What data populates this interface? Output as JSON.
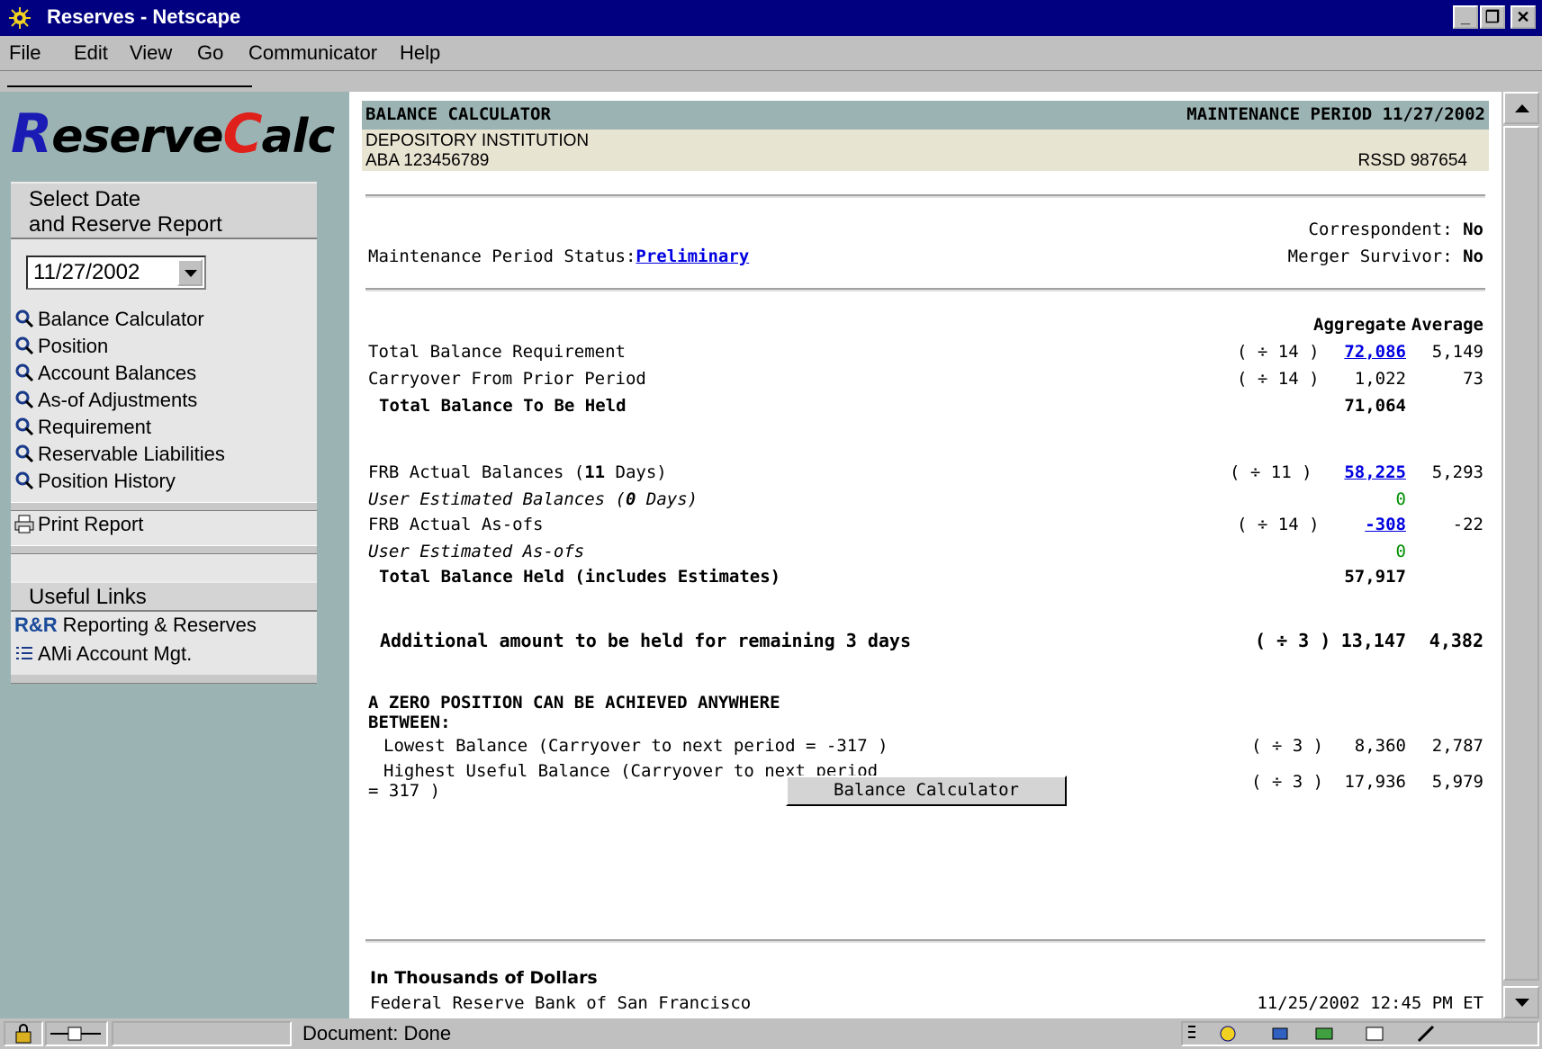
{
  "window": {
    "title": "Reserves - Netscape",
    "controls": [
      "_",
      "❐",
      "✕"
    ]
  },
  "menu": [
    "File",
    "Edit",
    "View",
    "Go",
    "Communicator",
    "Help"
  ],
  "sidebar": {
    "brand": {
      "r": "R",
      "mid": "eserve",
      "c": "C",
      "end": "alc"
    },
    "select_header": {
      "line1": "Select Date",
      "line2": "and Reserve Report"
    },
    "date_value": "11/27/2002",
    "nav": [
      "Balance Calculator",
      "Position",
      "Account Balances",
      "As-of Adjustments",
      "Requirement",
      "Reservable Liabilities",
      "Position History"
    ],
    "print_report": "Print Report",
    "useful_links_header": "Useful Links",
    "links": [
      {
        "badge": "R&R",
        "label": "Reporting & Reserves"
      },
      {
        "label": "AMi Account Mgt."
      }
    ]
  },
  "main": {
    "header_left": "BALANCE CALCULATOR",
    "header_right": "MAINTENANCE PERIOD 11/27/2002",
    "institution": "DEPOSITORY INSTITUTION",
    "aba": "ABA 123456789",
    "rssd": "RSSD 987654",
    "correspondent_label": "Correspondent:",
    "correspondent_value": "No",
    "merger_label": "Merger Survivor:",
    "merger_value": "No",
    "status_label": "Maintenance Period Status:",
    "status_value": "Preliminary",
    "col_aggregate": "Aggregate",
    "col_average": "Average",
    "rows": {
      "tbr": {
        "label": "Total Balance Requirement",
        "agg": "72,086",
        "div": "( ÷ 14 )",
        "avg": "5,149"
      },
      "carry": {
        "label": "Carryover From Prior Period",
        "agg": "1,022",
        "div": "( ÷ 14 )",
        "avg": "73"
      },
      "tbh": {
        "label": "Total Balance To Be Held",
        "agg": "71,064"
      },
      "frb_pre": "FRB Actual Balances (",
      "frb_days": "11",
      "frb_post": " Days)",
      "frb_agg": "58,225",
      "frb_div": "( ÷ 11 )",
      "frb_avg": "5,293",
      "ueb_pre": "User Estimated Balances (",
      "ueb_days": "0",
      "ueb_post": " Days)",
      "ueb_agg": "0",
      "asof": {
        "label": "FRB Actual As-ofs",
        "agg": "-308",
        "div": "( ÷ 14 )",
        "avg": "-22"
      },
      "ueasof": {
        "label": "User Estimated As-ofs",
        "agg": "0"
      },
      "held": {
        "label": "Total Balance Held (includes Estimates)",
        "agg": "57,917"
      },
      "additional": {
        "label": "Additional amount to be held for remaining 3 days",
        "agg": "13,147",
        "div": "( ÷ 3 )",
        "avg": "4,382"
      },
      "zero_line1": "A ZERO POSITION CAN BE ACHIEVED ANYWHERE",
      "zero_line2": "BETWEEN:",
      "lowest": {
        "label": "Lowest Balance (Carryover to next period = -317 )",
        "agg": "8,360",
        "div": "( ÷ 3 )",
        "avg": "2,787"
      },
      "highest": {
        "line1": "Highest Useful Balance (Carryover to next period",
        "line2": "= 317 )",
        "agg": "17,936",
        "div": "( ÷ 3 )",
        "avg": "5,979"
      }
    },
    "button": "Balance Calculator",
    "footer_units": "In Thousands of Dollars",
    "footer_bank": "Federal Reserve Bank of San Francisco",
    "footer_time": "11/25/2002 12:45 PM ET"
  },
  "status": {
    "text": "Document: Done"
  }
}
